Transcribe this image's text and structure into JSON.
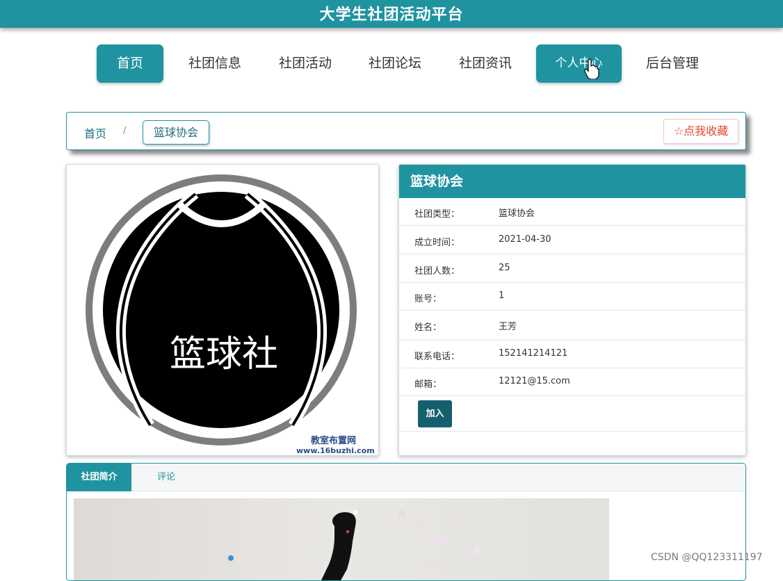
{
  "header": {
    "title": "大学生社团活动平台"
  },
  "nav": {
    "items": [
      {
        "label": "首页",
        "active": true
      },
      {
        "label": "社团信息",
        "active": false
      },
      {
        "label": "社团活动",
        "active": false
      },
      {
        "label": "社团论坛",
        "active": false
      },
      {
        "label": "社团资讯",
        "active": false
      },
      {
        "label": "个人中心",
        "active": true,
        "hovered": true
      },
      {
        "label": "后台管理",
        "active": false
      }
    ]
  },
  "breadcrumb": {
    "home": "首页",
    "separator": "/",
    "current": "篮球协会"
  },
  "favorite": {
    "icon": "star-outline-icon",
    "label": "点我收藏"
  },
  "club_image": {
    "logo_text": "篮球社",
    "watermark_line1": "教室布置网",
    "watermark_line2": "www.16buzhi.com"
  },
  "info": {
    "title": "篮球协会",
    "rows": [
      {
        "key": "社团类型：",
        "value": "篮球协会"
      },
      {
        "key": "成立时间：",
        "value": "2021-04-30"
      },
      {
        "key": "社团人数：",
        "value": "25"
      },
      {
        "key": "账号：",
        "value": "1"
      },
      {
        "key": "姓名：",
        "value": "王芳"
      },
      {
        "key": "联系电话：",
        "value": "152141214121"
      },
      {
        "key": "邮箱：",
        "value": "12121@15.com"
      }
    ],
    "join_label": "加入"
  },
  "tabs": {
    "items": [
      "社团简介",
      "评论"
    ],
    "active": "社团简介"
  },
  "watermark": "CSDN @QQ123311197",
  "colors": {
    "primary": "#1f93a0",
    "join": "#165f6f",
    "favorite": "#e8432d"
  }
}
